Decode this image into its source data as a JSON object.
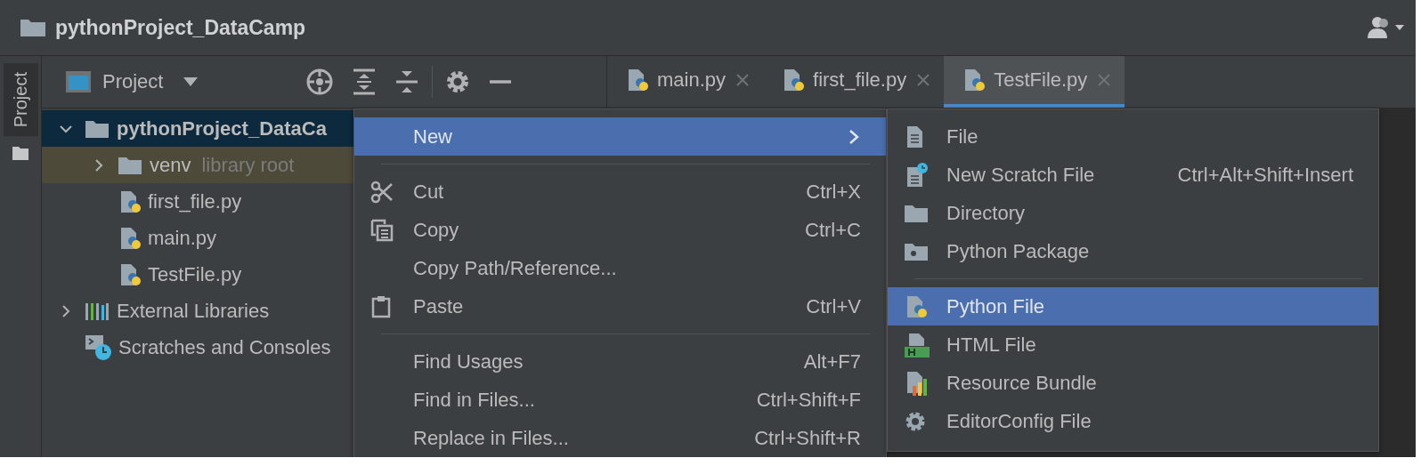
{
  "window": {
    "title": "pythonProject_DataCamp"
  },
  "tool_stripe": {
    "label": "Project",
    "selected": true
  },
  "project_panel": {
    "title": "Project",
    "tree": [
      {
        "label": "pythonProject_DataCa",
        "kind": "folder",
        "expanded": true,
        "selected": true,
        "highlighted": false,
        "children": [
          {
            "label": "venv",
            "hint": "library root",
            "kind": "folder",
            "expanded": false,
            "selected": false,
            "highlighted": true
          },
          {
            "label": "first_file.py",
            "kind": "python",
            "selected": false,
            "highlighted": false
          },
          {
            "label": "main.py",
            "kind": "python",
            "selected": false,
            "highlighted": false
          },
          {
            "label": "TestFile.py",
            "kind": "python",
            "selected": false,
            "highlighted": false
          }
        ]
      },
      {
        "label": "External Libraries",
        "kind": "libraries",
        "expanded": false,
        "selected": false,
        "highlighted": false
      },
      {
        "label": "Scratches and Consoles",
        "kind": "scratches",
        "selected": false,
        "highlighted": false
      }
    ]
  },
  "tabs": [
    {
      "label": "main.py",
      "selected": false
    },
    {
      "label": "first_file.py",
      "selected": false
    },
    {
      "label": "TestFile.py",
      "selected": true
    }
  ],
  "context_menu": {
    "items": [
      {
        "kind": "submenu",
        "label": "New",
        "selected": true
      },
      {
        "kind": "separator"
      },
      {
        "kind": "cut",
        "label": "Cut",
        "shortcut": "Ctrl+X",
        "selected": false
      },
      {
        "kind": "copy",
        "label": "Copy",
        "shortcut": "Ctrl+C",
        "selected": false
      },
      {
        "kind": "plain",
        "label": "Copy Path/Reference...",
        "selected": false
      },
      {
        "kind": "paste",
        "label": "Paste",
        "shortcut": "Ctrl+V",
        "selected": false
      },
      {
        "kind": "separator"
      },
      {
        "kind": "plain",
        "label": "Find Usages",
        "shortcut": "Alt+F7",
        "selected": false
      },
      {
        "kind": "plain",
        "label": "Find in Files...",
        "shortcut": "Ctrl+Shift+F",
        "selected": false
      },
      {
        "kind": "plain",
        "label": "Replace in Files...",
        "shortcut": "Ctrl+Shift+R",
        "selected": false
      }
    ]
  },
  "new_submenu": {
    "items": [
      {
        "kind": "file",
        "label": "File",
        "selected": false
      },
      {
        "kind": "scratch",
        "label": "New Scratch File",
        "shortcut": "Ctrl+Alt+Shift+Insert",
        "selected": false
      },
      {
        "kind": "directory",
        "label": "Directory",
        "selected": false
      },
      {
        "kind": "package",
        "label": "Python Package",
        "selected": false
      },
      {
        "kind": "separator"
      },
      {
        "kind": "python",
        "label": "Python File",
        "selected": true
      },
      {
        "kind": "html",
        "label": "HTML File",
        "selected": false
      },
      {
        "kind": "bundle",
        "label": "Resource Bundle",
        "selected": false
      },
      {
        "kind": "config",
        "label": "EditorConfig File",
        "selected": false
      }
    ]
  }
}
